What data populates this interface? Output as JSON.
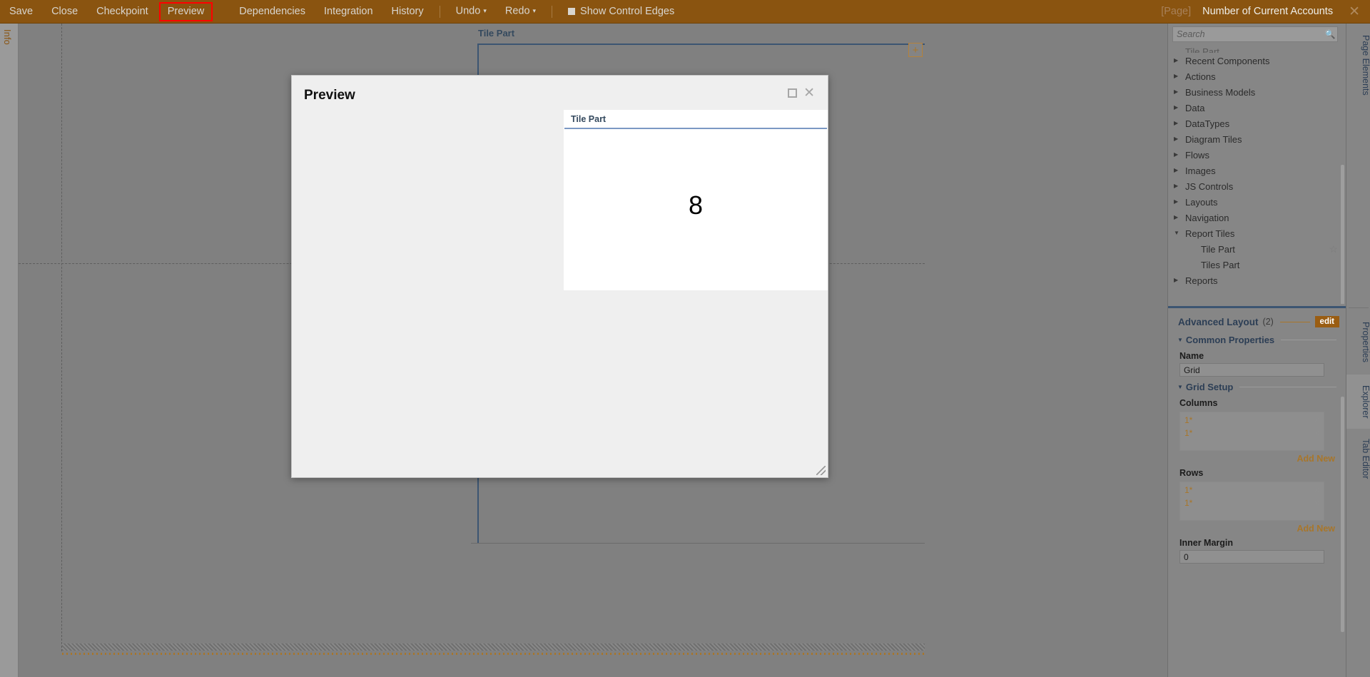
{
  "toolbar": {
    "items": [
      {
        "label": "Save",
        "highlighted": false
      },
      {
        "label": "Close",
        "highlighted": false
      },
      {
        "label": "Checkpoint",
        "highlighted": false
      },
      {
        "label": "Preview",
        "highlighted": true
      }
    ],
    "items2": [
      {
        "label": "Dependencies"
      },
      {
        "label": "Integration"
      },
      {
        "label": "History"
      }
    ],
    "undo_label": "Undo",
    "redo_label": "Redo",
    "show_control_edges_label": "Show Control Edges",
    "page_tag": "[Page]",
    "document_title": "Number of Current Accounts",
    "close_glyph": "✕",
    "highlight_color": "#ff0000",
    "bar_color": "#8a5410"
  },
  "left_rail": {
    "label": "Info"
  },
  "canvas": {
    "tile_widget_title": "Tile Part",
    "add_button_glyph": "+"
  },
  "dialog": {
    "title": "Preview",
    "maximize_icon": "maximize-icon",
    "close_glyph": "✕",
    "tile": {
      "title": "Tile Part",
      "value": "8",
      "accent_color": "#7b98c4"
    }
  },
  "right_panel": {
    "search": {
      "placeholder": "Search",
      "value": "",
      "icon": "search-icon"
    },
    "tree": {
      "clipped_top_label": "Tile Part",
      "items": [
        {
          "label": "Recent Components",
          "state": "closed",
          "child": false,
          "star": false
        },
        {
          "label": "Actions",
          "state": "closed",
          "child": false,
          "star": false
        },
        {
          "label": "Business Models",
          "state": "closed",
          "child": false,
          "star": false
        },
        {
          "label": "Data",
          "state": "closed",
          "child": false,
          "star": false
        },
        {
          "label": "DataTypes",
          "state": "closed",
          "child": false,
          "star": false
        },
        {
          "label": "Diagram Tiles",
          "state": "closed",
          "child": false,
          "star": false
        },
        {
          "label": "Flows",
          "state": "closed",
          "child": false,
          "star": false
        },
        {
          "label": "Images",
          "state": "closed",
          "child": false,
          "star": false
        },
        {
          "label": "JS Controls",
          "state": "closed",
          "child": false,
          "star": false
        },
        {
          "label": "Layouts",
          "state": "closed",
          "child": false,
          "star": false
        },
        {
          "label": "Navigation",
          "state": "closed",
          "child": false,
          "star": false
        },
        {
          "label": "Report Tiles",
          "state": "open",
          "child": false,
          "star": false
        },
        {
          "label": "Tile Part",
          "state": "none",
          "child": true,
          "star": true
        },
        {
          "label": "Tiles Part",
          "state": "none",
          "child": true,
          "star": false
        },
        {
          "label": "Reports",
          "state": "closed",
          "child": false,
          "star": false
        }
      ]
    },
    "properties": {
      "header_title": "Advanced Layout",
      "header_count": "(2)",
      "edit_label": "edit",
      "groups": [
        {
          "title": "Common Properties"
        },
        {
          "title": "Grid Setup"
        }
      ],
      "name_label": "Name",
      "name_value": "Grid",
      "columns_label": "Columns",
      "columns": [
        "1*",
        "1*"
      ],
      "columns_add_new": "Add New",
      "rows_label": "Rows",
      "rows": [
        "1*",
        "1*"
      ],
      "rows_add_new": "Add New",
      "inner_margin_label": "Inner Margin",
      "inner_margin_value": "0",
      "edit_icon": "pencil-icon",
      "delete_icon": "close-icon"
    }
  },
  "right_rail": {
    "tabs": [
      {
        "label": "Page Elements",
        "active": false
      },
      {
        "label": "Properties",
        "active": false
      },
      {
        "label": "Explorer",
        "active": true
      },
      {
        "label": "Tab Editor",
        "active": false
      }
    ]
  }
}
